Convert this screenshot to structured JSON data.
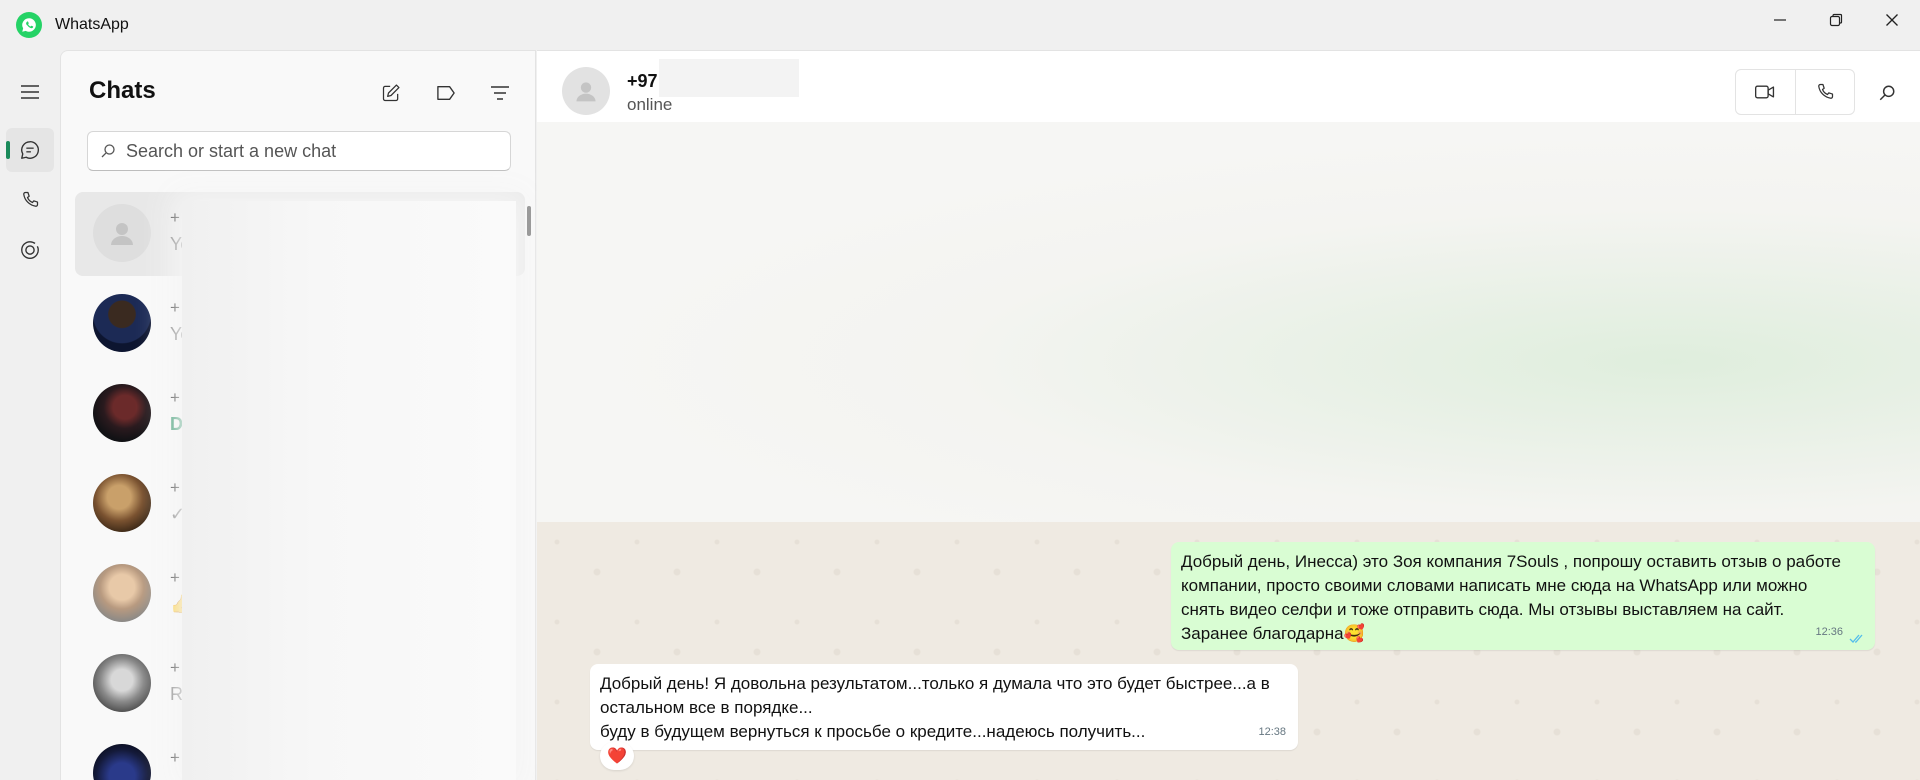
{
  "app": {
    "title": "WhatsApp"
  },
  "sidebar": {
    "title": "Chats",
    "search_placeholder": "Search or start a new chat"
  },
  "chats": [
    {
      "name": "+",
      "preview": "Yo",
      "preview_style": "normal"
    },
    {
      "name": "+",
      "preview": "Yo",
      "preview_style": "normal"
    },
    {
      "name": "+",
      "preview": "D",
      "preview_style": "green"
    },
    {
      "name": "+",
      "preview": "✓",
      "preview_style": "normal"
    },
    {
      "name": "+",
      "preview": "👍",
      "preview_style": "normal"
    },
    {
      "name": "+",
      "preview": "Re",
      "preview_style": "normal"
    },
    {
      "name": "+",
      "preview": "",
      "preview_style": "normal"
    }
  ],
  "conversation": {
    "contact_name": "+97",
    "status": "online",
    "messages": [
      {
        "direction": "out",
        "lines": [
          "Добрый день, Инесса) это Зоя компания 7Souls , попрошу оставить отзыв о работе",
          "компании, просто своими словами написать мне сюда на WhatsApp или можно",
          "снять видео селфи и тоже отправить сюда. Мы отзывы выставляем на сайт.",
          "Заранее благодарна🥰"
        ],
        "time": "12:36"
      },
      {
        "direction": "in",
        "lines": [
          "Добрый день! Я довольна результатом...только я думала что это будет  быстрее...а в",
          "остальном все в порядке...",
          "буду в будущем вернуться к просьбе о кредите...надеюсь получить..."
        ],
        "time": "12:38",
        "reaction": "❤️"
      }
    ]
  },
  "colors": {
    "accent": "#1a8a5a",
    "brand": "#25d366",
    "outgoing_bubble": "#d9fdd3",
    "read_ticks": "#53bdeb"
  }
}
